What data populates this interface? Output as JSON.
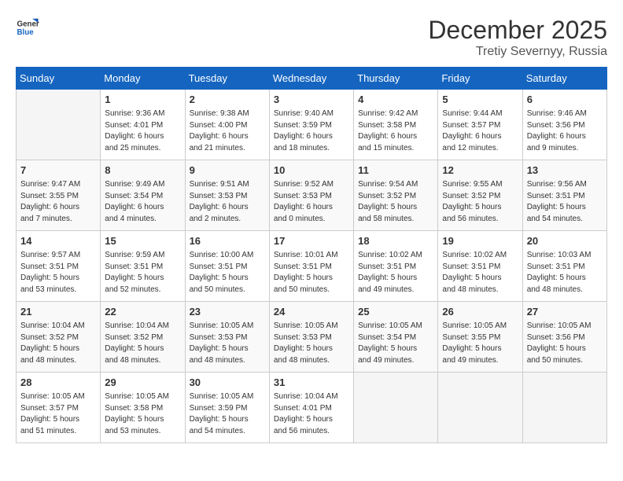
{
  "logo": {
    "line1": "General",
    "line2": "Blue"
  },
  "header": {
    "month": "December 2025",
    "location": "Tretiy Severnyy, Russia"
  },
  "days_of_week": [
    "Sunday",
    "Monday",
    "Tuesday",
    "Wednesday",
    "Thursday",
    "Friday",
    "Saturday"
  ],
  "weeks": [
    [
      {
        "day": "",
        "content": ""
      },
      {
        "day": "1",
        "content": "Sunrise: 9:36 AM\nSunset: 4:01 PM\nDaylight: 6 hours\nand 25 minutes."
      },
      {
        "day": "2",
        "content": "Sunrise: 9:38 AM\nSunset: 4:00 PM\nDaylight: 6 hours\nand 21 minutes."
      },
      {
        "day": "3",
        "content": "Sunrise: 9:40 AM\nSunset: 3:59 PM\nDaylight: 6 hours\nand 18 minutes."
      },
      {
        "day": "4",
        "content": "Sunrise: 9:42 AM\nSunset: 3:58 PM\nDaylight: 6 hours\nand 15 minutes."
      },
      {
        "day": "5",
        "content": "Sunrise: 9:44 AM\nSunset: 3:57 PM\nDaylight: 6 hours\nand 12 minutes."
      },
      {
        "day": "6",
        "content": "Sunrise: 9:46 AM\nSunset: 3:56 PM\nDaylight: 6 hours\nand 9 minutes."
      }
    ],
    [
      {
        "day": "7",
        "content": "Sunrise: 9:47 AM\nSunset: 3:55 PM\nDaylight: 6 hours\nand 7 minutes."
      },
      {
        "day": "8",
        "content": "Sunrise: 9:49 AM\nSunset: 3:54 PM\nDaylight: 6 hours\nand 4 minutes."
      },
      {
        "day": "9",
        "content": "Sunrise: 9:51 AM\nSunset: 3:53 PM\nDaylight: 6 hours\nand 2 minutes."
      },
      {
        "day": "10",
        "content": "Sunrise: 9:52 AM\nSunset: 3:53 PM\nDaylight: 6 hours\nand 0 minutes."
      },
      {
        "day": "11",
        "content": "Sunrise: 9:54 AM\nSunset: 3:52 PM\nDaylight: 5 hours\nand 58 minutes."
      },
      {
        "day": "12",
        "content": "Sunrise: 9:55 AM\nSunset: 3:52 PM\nDaylight: 5 hours\nand 56 minutes."
      },
      {
        "day": "13",
        "content": "Sunrise: 9:56 AM\nSunset: 3:51 PM\nDaylight: 5 hours\nand 54 minutes."
      }
    ],
    [
      {
        "day": "14",
        "content": "Sunrise: 9:57 AM\nSunset: 3:51 PM\nDaylight: 5 hours\nand 53 minutes."
      },
      {
        "day": "15",
        "content": "Sunrise: 9:59 AM\nSunset: 3:51 PM\nDaylight: 5 hours\nand 52 minutes."
      },
      {
        "day": "16",
        "content": "Sunrise: 10:00 AM\nSunset: 3:51 PM\nDaylight: 5 hours\nand 50 minutes."
      },
      {
        "day": "17",
        "content": "Sunrise: 10:01 AM\nSunset: 3:51 PM\nDaylight: 5 hours\nand 50 minutes."
      },
      {
        "day": "18",
        "content": "Sunrise: 10:02 AM\nSunset: 3:51 PM\nDaylight: 5 hours\nand 49 minutes."
      },
      {
        "day": "19",
        "content": "Sunrise: 10:02 AM\nSunset: 3:51 PM\nDaylight: 5 hours\nand 48 minutes."
      },
      {
        "day": "20",
        "content": "Sunrise: 10:03 AM\nSunset: 3:51 PM\nDaylight: 5 hours\nand 48 minutes."
      }
    ],
    [
      {
        "day": "21",
        "content": "Sunrise: 10:04 AM\nSunset: 3:52 PM\nDaylight: 5 hours\nand 48 minutes."
      },
      {
        "day": "22",
        "content": "Sunrise: 10:04 AM\nSunset: 3:52 PM\nDaylight: 5 hours\nand 48 minutes."
      },
      {
        "day": "23",
        "content": "Sunrise: 10:05 AM\nSunset: 3:53 PM\nDaylight: 5 hours\nand 48 minutes."
      },
      {
        "day": "24",
        "content": "Sunrise: 10:05 AM\nSunset: 3:53 PM\nDaylight: 5 hours\nand 48 minutes."
      },
      {
        "day": "25",
        "content": "Sunrise: 10:05 AM\nSunset: 3:54 PM\nDaylight: 5 hours\nand 49 minutes."
      },
      {
        "day": "26",
        "content": "Sunrise: 10:05 AM\nSunset: 3:55 PM\nDaylight: 5 hours\nand 49 minutes."
      },
      {
        "day": "27",
        "content": "Sunrise: 10:05 AM\nSunset: 3:56 PM\nDaylight: 5 hours\nand 50 minutes."
      }
    ],
    [
      {
        "day": "28",
        "content": "Sunrise: 10:05 AM\nSunset: 3:57 PM\nDaylight: 5 hours\nand 51 minutes."
      },
      {
        "day": "29",
        "content": "Sunrise: 10:05 AM\nSunset: 3:58 PM\nDaylight: 5 hours\nand 53 minutes."
      },
      {
        "day": "30",
        "content": "Sunrise: 10:05 AM\nSunset: 3:59 PM\nDaylight: 5 hours\nand 54 minutes."
      },
      {
        "day": "31",
        "content": "Sunrise: 10:04 AM\nSunset: 4:01 PM\nDaylight: 5 hours\nand 56 minutes."
      },
      {
        "day": "",
        "content": ""
      },
      {
        "day": "",
        "content": ""
      },
      {
        "day": "",
        "content": ""
      }
    ]
  ]
}
